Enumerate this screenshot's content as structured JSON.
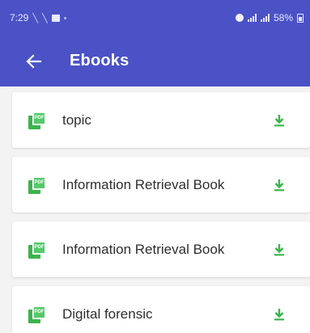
{
  "status_bar": {
    "time": "7:29",
    "battery": "58%"
  },
  "app_bar": {
    "title": "Ebooks",
    "back_icon": "arrow-left-icon"
  },
  "colors": {
    "primary": "#4a52c6",
    "icon_green": "#39b54a",
    "background": "#f3f3f3"
  },
  "books": [
    {
      "label": "topic",
      "file_icon": "pdf-file-icon",
      "action_icon": "download-icon"
    },
    {
      "label": "Information Retrieval Book",
      "file_icon": "pdf-file-icon",
      "action_icon": "download-icon"
    },
    {
      "label": "Information Retrieval Book",
      "file_icon": "pdf-file-icon",
      "action_icon": "download-icon"
    },
    {
      "label": "Digital forensic",
      "file_icon": "pdf-file-icon",
      "action_icon": "download-icon"
    }
  ]
}
